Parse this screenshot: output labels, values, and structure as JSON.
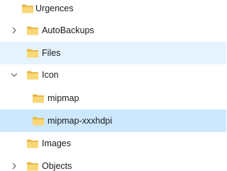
{
  "tree": {
    "items": [
      {
        "label": "Urgences",
        "level": 0,
        "expander": "none",
        "state": "normal"
      },
      {
        "label": "AutoBackups",
        "level": 1,
        "expander": "collapsed",
        "state": "normal"
      },
      {
        "label": "Files",
        "level": 1,
        "expander": "none",
        "state": "hover"
      },
      {
        "label": "Icon",
        "level": 1,
        "expander": "expanded",
        "state": "normal"
      },
      {
        "label": "mipmap",
        "level": 2,
        "expander": "none",
        "state": "normal"
      },
      {
        "label": "mipmap-xxxhdpi",
        "level": 2,
        "expander": "none",
        "state": "selected"
      },
      {
        "label": "Images",
        "level": 1,
        "expander": "none",
        "state": "normal"
      },
      {
        "label": "Objects",
        "level": 1,
        "expander": "collapsed",
        "state": "normal"
      }
    ]
  },
  "colors": {
    "selected_bg": "#cce8ff",
    "hover_bg": "#e5f3ff",
    "folder_fill": "#f8d775",
    "folder_tab": "#e8b84a"
  },
  "icons": {
    "folder": "folder-icon",
    "collapsed": "chevron-right-icon",
    "expanded": "chevron-down-icon"
  }
}
